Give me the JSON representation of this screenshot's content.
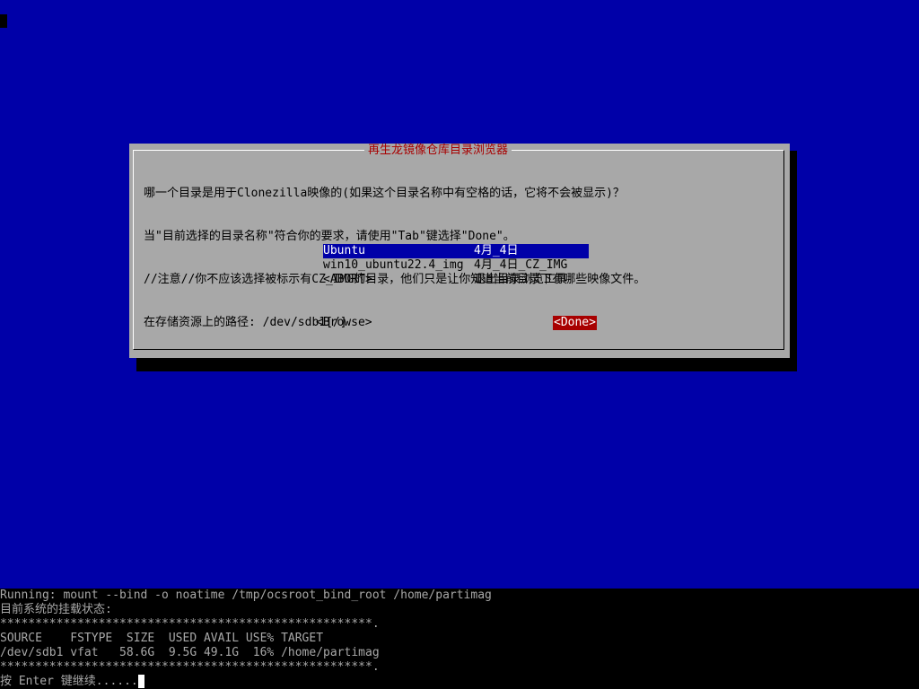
{
  "dialog": {
    "title": "再生龙镜像仓库目录浏览器",
    "lines": [
      "哪一个目录是用于Clonezilla映像的(如果这个目录名称中有空格的话，它将不会被显示)？",
      "当\"目前选择的目录名称\"符合你的要求，请使用\"Tab\"键选择\"Done\"。",
      "//注意//你不应该选择被标示有CZ_IMG的目录，他们只是让你知道当前目录下有哪些映像文件。",
      "在存储资源上的路径: /dev/sdb1[/]",
      "目前选择的目录名称: \"/\""
    ],
    "menu": [
      {
        "name": "Ubuntu",
        "desc": "4月_4日",
        "selected": true
      },
      {
        "name": "win10_ubuntu22.4_img",
        "desc": "4月_4日_CZ_IMG",
        "selected": false
      },
      {
        "name": "<ABORT>",
        "desc": "退出目录浏览工具",
        "selected": false
      }
    ],
    "browse_label": "<Browse>",
    "done_label": "<Done>"
  },
  "console": {
    "lines": [
      "Running: mount --bind -o noatime /tmp/ocsroot_bind_root /home/partimag",
      "目前系统的挂载状态:",
      "*****************************************************.",
      "SOURCE    FSTYPE  SIZE  USED AVAIL USE% TARGET",
      "/dev/sdb1 vfat   58.6G  9.5G 49.1G  16% /home/partimag",
      "*****************************************************.",
      "按 Enter 键继续......"
    ]
  },
  "colors": {
    "background": "#0000a8",
    "dialog": "#a8a8a8",
    "title": "#a80000",
    "selection": "#0000a8",
    "done_button": "#a80000",
    "console_bg": "#000000",
    "console_text": "#a8a8a8"
  }
}
